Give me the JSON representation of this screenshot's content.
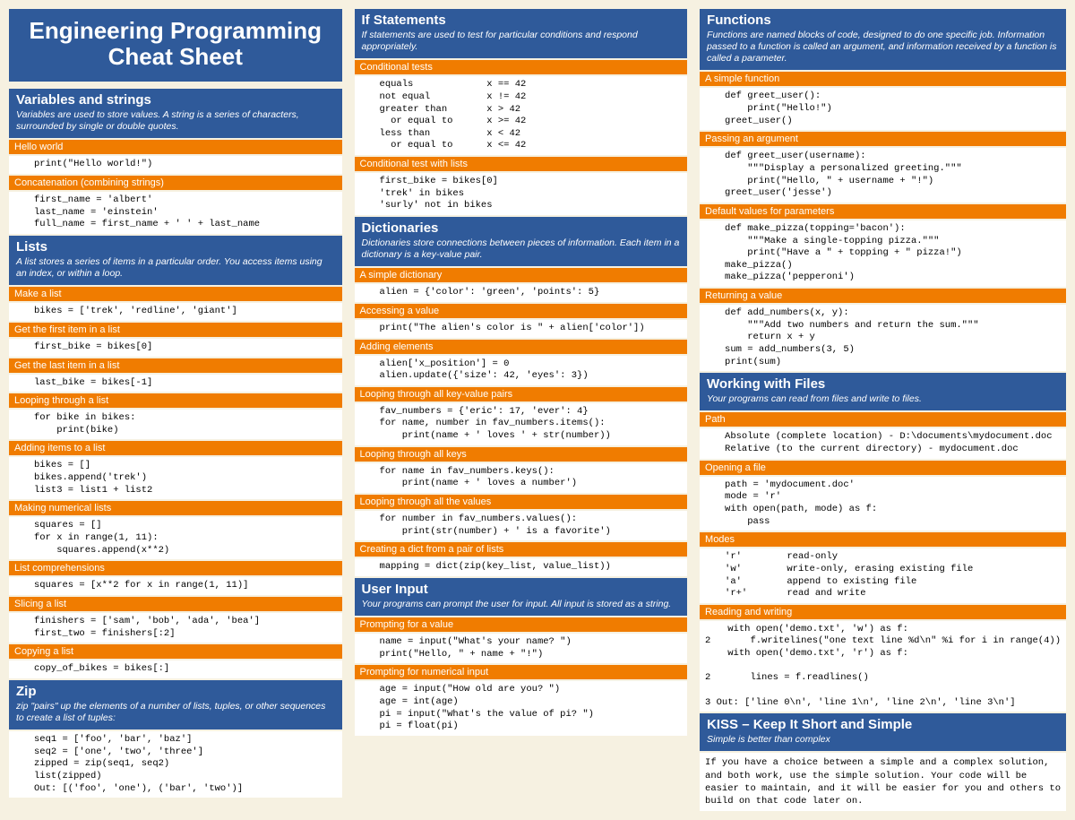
{
  "title": "Engineering Programming Cheat Sheet",
  "col1": {
    "variables": {
      "title": "Variables and strings",
      "desc": "Variables are used to store values. A string is a series of characters, surrounded by single or double quotes.",
      "hello_sub": "Hello world",
      "hello_code": "print(\"Hello world!\")",
      "concat_sub": "Concatenation (combining strings)",
      "concat_code": "first_name = 'albert'\nlast_name = 'einstein'\nfull_name = first_name + ' ' + last_name"
    },
    "lists": {
      "title": "Lists",
      "desc": "A list stores a series of items in a particular order. You access items using an index, or within a loop.",
      "make_sub": "Make a list",
      "make_code": "bikes = ['trek', 'redline', 'giant']",
      "first_sub": "Get the first item in a list",
      "first_code": "first_bike = bikes[0]",
      "last_sub": "Get the last item in a list",
      "last_code": "last_bike = bikes[-1]",
      "loop_sub": "Looping through a list",
      "loop_code": "for bike in bikes:\n    print(bike)",
      "add_sub": "Adding items to a list",
      "add_code": "bikes = []\nbikes.append('trek')\nlist3 = list1 + list2",
      "num_sub": "Making numerical lists",
      "num_code": "squares = []\nfor x in range(1, 11):\n    squares.append(x**2)",
      "comp_sub": "List comprehensions",
      "comp_code": "squares = [x**2 for x in range(1, 11)]",
      "slice_sub": "Slicing a list",
      "slice_code": "finishers = ['sam', 'bob', 'ada', 'bea']\nfirst_two = finishers[:2]",
      "copy_sub": "Copying a list",
      "copy_code": "copy_of_bikes = bikes[:]"
    },
    "zip": {
      "title": "Zip",
      "desc": "zip \"pairs\" up the elements of a number of lists, tuples, or other sequences to create a list of tuples:",
      "code": "seq1 = ['foo', 'bar', 'baz']\nseq2 = ['one', 'two', 'three']\nzipped = zip(seq1, seq2)\nlist(zipped)\nOut: [('foo', 'one'), ('bar', 'two')]"
    }
  },
  "col2": {
    "if": {
      "title": "If Statements",
      "desc": "If statements are used to test for particular conditions and respond appropriately.",
      "cond_sub": "Conditional tests",
      "cond_code": "equals             x == 42\nnot equal          x != 42\ngreater than       x > 42\n  or equal to      x >= 42\nless than          x < 42\n  or equal to      x <= 42",
      "list_sub": "Conditional test with lists",
      "list_code": "first_bike = bikes[0]\n'trek' in bikes\n'surly' not in bikes"
    },
    "dict": {
      "title": "Dictionaries",
      "desc": "Dictionaries store connections between pieces of information. Each item in a dictionary is a key-value pair.",
      "simple_sub": "A simple dictionary",
      "simple_code": "alien = {'color': 'green', 'points': 5}",
      "access_sub": "Accessing a value",
      "access_code": "print(\"The alien's color is \" + alien['color'])",
      "add_sub": "Adding elements",
      "add_code": "alien['x_position'] = 0\nalien.update({'size': 42, 'eyes': 3})",
      "kv_sub": "Looping through all key-value pairs",
      "kv_code": "fav_numbers = {'eric': 17, 'ever': 4}\nfor name, number in fav_numbers.items():\n    print(name + ' loves ' + str(number))",
      "keys_sub": "Looping through all keys",
      "keys_code": "for name in fav_numbers.keys():\n    print(name + ' loves a number')",
      "vals_sub": "Looping through all the values",
      "vals_code": "for number in fav_numbers.values():\n    print(str(number) + ' is a favorite')",
      "pair_sub": "Creating a dict from a pair of lists",
      "pair_code": "mapping = dict(zip(key_list, value_list))"
    },
    "input": {
      "title": "User Input",
      "desc": "Your programs can prompt the user for input. All input is stored as a string.",
      "val_sub": "Prompting for a value",
      "val_code": "name = input(\"What's your name? \")\nprint(\"Hello, \" + name + \"!\")",
      "num_sub": "Prompting for numerical input",
      "num_code": "age = input(\"How old are you? \")\nage = int(age)\npi = input(\"What's the value of pi? \")\npi = float(pi)"
    }
  },
  "col3": {
    "fn": {
      "title": "Functions",
      "desc": "Functions are named blocks of code, designed to do one specific job. Information passed to a function is called an argument, and information received by a function is called a parameter.",
      "simple_sub": "A simple function",
      "simple_code": "def greet_user():\n    print(\"Hello!\")\ngreet_user()",
      "arg_sub": "Passing an argument",
      "arg_code": "def greet_user(username):\n    \"\"\"Display a personalized greeting.\"\"\"\n    print(\"Hello, \" + username + \"!\")\ngreet_user('jesse')",
      "def_sub": "Default values for parameters",
      "def_code": "def make_pizza(topping='bacon'):\n    \"\"\"Make a single-topping pizza.\"\"\"\n    print(\"Have a \" + topping + \" pizza!\")\nmake_pizza()\nmake_pizza('pepperoni')",
      "ret_sub": "Returning a value",
      "ret_code": "def add_numbers(x, y):\n    \"\"\"Add two numbers and return the sum.\"\"\"\n    return x + y\nsum = add_numbers(3, 5)\nprint(sum)"
    },
    "files": {
      "title": "Working with Files",
      "desc": "Your programs can read from files and write to files.",
      "path_sub": "Path",
      "path_code": "Absolute (complete location) - D:\\documents\\mydocument.doc\nRelative (to the current directory) - mydocument.doc",
      "open_sub": "Opening a file",
      "open_code": "path = 'mydocument.doc'\nmode = 'r'\nwith open(path, mode) as f:\n    pass",
      "modes_sub": "Modes",
      "modes_code": "'r'        read-only\n'w'        write-only, erasing existing file\n'a'        append to existing file\n'r+'       read and write",
      "rw_sub": "Reading and writing",
      "rw_code": "    with open('demo.txt', 'w') as f:\n2       f.writelines(\"one text line %d\\n\" %i for i in range(4))\n    with open('demo.txt', 'r') as f:\n\n2       lines = f.readlines()\n\n3 Out: ['line 0\\n', 'line 1\\n', 'line 2\\n', 'line 3\\n']"
    },
    "kiss": {
      "title": "KISS – Keep It Short and Simple",
      "desc": "Simple is better than complex",
      "body": "If you have a choice between a simple and a complex solution, and both work, use the simple solution. Your code will be easier to maintain, and it will be easier for you and others to build on that code later on."
    }
  }
}
